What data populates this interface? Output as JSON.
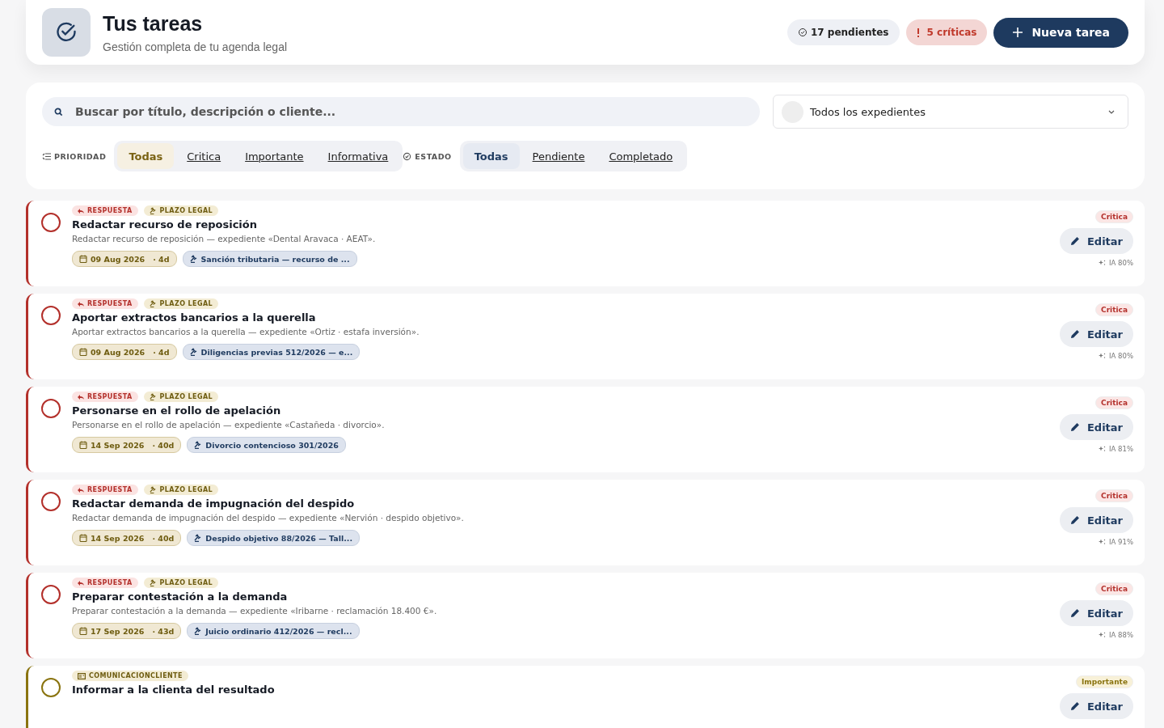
{
  "header": {
    "title": "Tus tareas",
    "subtitle": "Gestión completa de tu agenda legal",
    "pending": "17 pendientes",
    "critical_count": "5 críticas",
    "new_button": "Nueva tarea"
  },
  "search": {
    "placeholder": "Buscar por título, descripción o cliente..."
  },
  "case_select": {
    "value": "Todos los expedientes"
  },
  "priority_filter": {
    "label": "PRIORIDAD",
    "options": [
      {
        "label": "Todas",
        "selected": true
      },
      {
        "label": "Critica",
        "selected": false
      },
      {
        "label": "Importante",
        "selected": false
      },
      {
        "label": "Informativa",
        "selected": false
      }
    ]
  },
  "status_filter": {
    "label": "ESTADO",
    "options": [
      {
        "label": "Todas",
        "selected": true
      },
      {
        "label": "Pendiente",
        "selected": false
      },
      {
        "label": "Completado",
        "selected": false
      }
    ]
  },
  "tasks": [
    {
      "kind": "critica",
      "priority_label": "Critica",
      "tags": [
        {
          "kind": "respuesta",
          "label": "RESPUESTA"
        },
        {
          "kind": "plazo",
          "label": "PLAZO LEGAL"
        }
      ],
      "title": "Redactar recurso de reposición",
      "completed": false,
      "description": "Redactar recurso de reposición — expediente «Dental Aravaca · AEAT».",
      "date": "09 Aug 2026",
      "days": "· 4d",
      "case": "Sanción tributaria — recurso de ...",
      "edit": "Editar",
      "ai": "IA 80%"
    },
    {
      "kind": "critica",
      "priority_label": "Critica",
      "tags": [
        {
          "kind": "respuesta",
          "label": "RESPUESTA"
        },
        {
          "kind": "plazo",
          "label": "PLAZO LEGAL"
        }
      ],
      "title": "Aportar extractos bancarios a la querella",
      "completed": false,
      "description": "Aportar extractos bancarios a la querella — expediente «Ortiz · estafa inversión».",
      "date": "09 Aug 2026",
      "days": "· 4d",
      "case": "Diligencias previas 512/2026 — e...",
      "edit": "Editar",
      "ai": "IA 80%"
    },
    {
      "kind": "critica",
      "priority_label": "Critica",
      "tags": [
        {
          "kind": "respuesta",
          "label": "RESPUESTA"
        },
        {
          "kind": "plazo",
          "label": "PLAZO LEGAL"
        }
      ],
      "title": "Personarse en el rollo de apelación",
      "completed": false,
      "description": "Personarse en el rollo de apelación — expediente «Castañeda · divorcio».",
      "date": "14 Sep 2026",
      "days": "· 40d",
      "case": "Divorcio contencioso 301/2026",
      "edit": "Editar",
      "ai": "IA 81%"
    },
    {
      "kind": "critica",
      "priority_label": "Critica",
      "tags": [
        {
          "kind": "respuesta",
          "label": "RESPUESTA"
        },
        {
          "kind": "plazo",
          "label": "PLAZO LEGAL"
        }
      ],
      "title": "Redactar demanda de impugnación del despido",
      "completed": false,
      "description": "Redactar demanda de impugnación del despido — expediente «Nervión · despido objetivo».",
      "date": "14 Sep 2026",
      "days": "· 40d",
      "case": "Despido objetivo 88/2026 — Tall...",
      "edit": "Editar",
      "ai": "IA 91%"
    },
    {
      "kind": "critica",
      "priority_label": "Critica",
      "tags": [
        {
          "kind": "respuesta",
          "label": "RESPUESTA"
        },
        {
          "kind": "plazo",
          "label": "PLAZO LEGAL"
        }
      ],
      "title": "Preparar contestación a la demanda",
      "completed": false,
      "description": "Preparar contestación a la demanda — expediente «Iribarne · reclamación 18.400 €».",
      "date": "17 Sep 2026",
      "days": "· 43d",
      "case": "Juicio ordinario 412/2026 — recl...",
      "edit": "Editar",
      "ai": "IA 88%"
    },
    {
      "kind": "importante",
      "priority_label": "Importante",
      "tags": [
        {
          "kind": "comunicacion",
          "label": "COMUNICACIONCLIENTE"
        }
      ],
      "title": "Informar a la clienta del resultado",
      "completed": false,
      "edit": "Editar"
    }
  ]
}
